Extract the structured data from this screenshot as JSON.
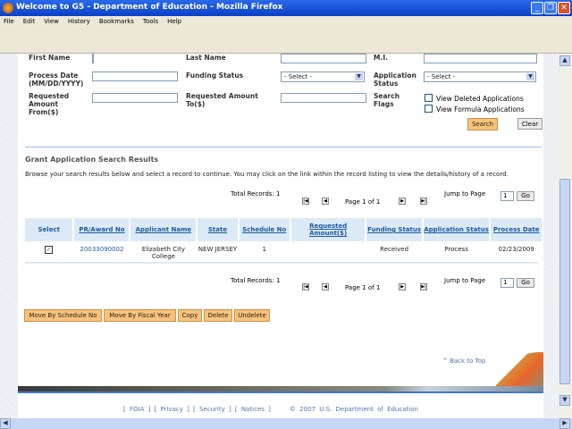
{
  "window": {
    "title": "Welcome to G5 - Department of Education - Mozilla Firefox"
  },
  "menu": [
    "File",
    "Edit",
    "View",
    "History",
    "Bookmarks",
    "Tools",
    "Help"
  ],
  "form": {
    "first_name": "First Name",
    "last_name": "Last Name",
    "mi": "M.I.",
    "process_date": "Process Date (MM/DD/YYYY)",
    "funding_status": "Funding Status",
    "funding_select": "- Select -",
    "application_status": "Application Status",
    "application_select": "- Select -",
    "req_from": "Requested Amount From($)",
    "req_to": "Requested Amount To($)",
    "search_flags": "Search Flags",
    "view_deleted": "View Deleted Applications",
    "view_formula": "View Formula Applications",
    "search": "Search",
    "clear": "Clear"
  },
  "results": {
    "title": "Grant Application Search Results",
    "instructions": "Browse your search results below and select a record to continue. You may click on the link within the record listing to view the details/history of a record.",
    "total": "Total Records: 1",
    "page": "Page 1 of 1",
    "jump": "Jump to Page",
    "jump_value": "1",
    "go": "Go",
    "columns": [
      "Select",
      "PR/Award No",
      "Applicant Name",
      "State",
      "Schedule No",
      "Requested Amount($)",
      "Funding Status",
      "Application Status",
      "Process Date"
    ],
    "rows": [
      {
        "selected": true,
        "award": "20033090002",
        "applicant": "Elizabeth City College",
        "state": "NEW JERSEY",
        "schedule": "1",
        "amount": "",
        "funding": "Received",
        "status": "Process",
        "date": "02/23/2009"
      }
    ]
  },
  "actions": [
    "Move By Schedule No",
    "Move By Fiscal Year",
    "Copy",
    "Delete",
    "Undelete"
  ],
  "footer": {
    "back_to_top": "^ Back to Top",
    "links": [
      "FOIA",
      "Privacy",
      "Security",
      "Notices"
    ],
    "copyright": "© 2007 U.S. Department of Education"
  }
}
